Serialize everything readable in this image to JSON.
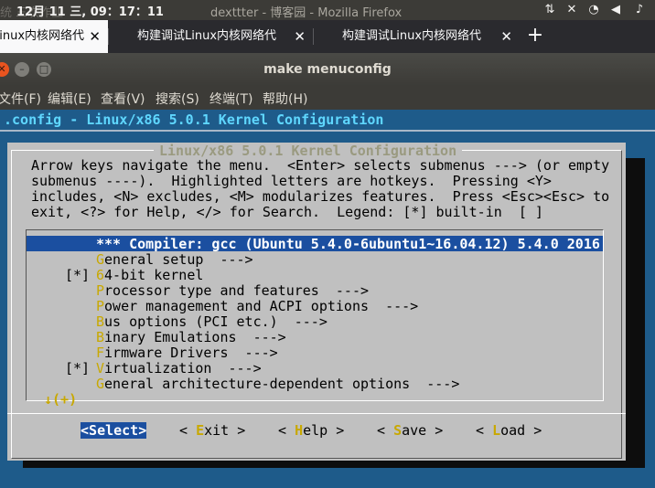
{
  "top_panel": {
    "clock": "12月 11 三, 09：17：11",
    "ghost_text": "统  三次作业",
    "ghost_title": "dexttter - 博客园 - Mozilla Firefox",
    "tray_icons": [
      "audio-icon",
      "keyboard-icon",
      "wifi-icon",
      "volume-icon"
    ]
  },
  "browser": {
    "tabs": [
      {
        "label": "Linux内核网络代",
        "active": true
      },
      {
        "label": "构建调试Linux内核网络代",
        "active": false
      },
      {
        "label": "构建调试Linux内核网络代",
        "active": false
      }
    ],
    "new_tab_symbol": "+",
    "close_symbol": "✕"
  },
  "terminal": {
    "title": "make menuconfig",
    "menus": [
      "文件(F)",
      "编辑(E)",
      "查看(V)",
      "搜索(S)",
      "终端(T)",
      "帮助(H)"
    ]
  },
  "kconfig": {
    "header": ".config - Linux/x86 5.0.1 Kernel Configuration",
    "dialog_title": "Linux/x86 5.0.1 Kernel Configuration",
    "help_lines": [
      "Arrow keys navigate the menu.  <Enter> selects submenus ---> (or empty",
      "submenus ----).  Highlighted letters are hotkeys.  Pressing <Y>",
      "includes, <N> excludes, <M> modularizes features.  Press <Esc><Esc> to",
      "exit, <?> for Help, </> for Search.  Legend: [*] built-in  [ ]"
    ],
    "items": [
      {
        "mark": "",
        "hotkey": "",
        "rest": "*** Compiler: gcc (Ubuntu 5.4.0-6ubuntu1~16.04.12) 5.4.0 2016",
        "selected": true
      },
      {
        "mark": "",
        "hotkey": "G",
        "rest": "eneral setup  --->",
        "selected": false
      },
      {
        "mark": "[*]",
        "hotkey": "6",
        "rest": "4-bit kernel",
        "selected": false
      },
      {
        "mark": "",
        "hotkey": "P",
        "rest": "rocessor type and features  --->",
        "selected": false
      },
      {
        "mark": "",
        "hotkey": "P",
        "rest": "ower management and ACPI options  --->",
        "selected": false
      },
      {
        "mark": "",
        "hotkey": "B",
        "rest": "us options (PCI etc.)  --->",
        "selected": false
      },
      {
        "mark": "",
        "hotkey": "B",
        "rest": "inary Emulations  --->",
        "selected": false
      },
      {
        "mark": "",
        "hotkey": "F",
        "rest": "irmware Drivers  --->",
        "selected": false
      },
      {
        "mark": "[*]",
        "hotkey": "V",
        "rest": "irtualization  --->",
        "selected": false
      },
      {
        "mark": "",
        "hotkey": "G",
        "rest": "eneral architecture-dependent options  --->",
        "selected": false
      }
    ],
    "more_indicator": "↓(+)",
    "buttons": [
      {
        "open": "<",
        "hotkey": "S",
        "rest": "elect>",
        "focus": true
      },
      {
        "open": "< ",
        "hotkey": "E",
        "rest": "xit >",
        "focus": false
      },
      {
        "open": "< ",
        "hotkey": "H",
        "rest": "elp >",
        "focus": false
      },
      {
        "open": "< ",
        "hotkey": "S",
        "rest": "ave >",
        "focus": false
      },
      {
        "open": "< ",
        "hotkey": "L",
        "rest": "oad >",
        "focus": false
      }
    ]
  }
}
